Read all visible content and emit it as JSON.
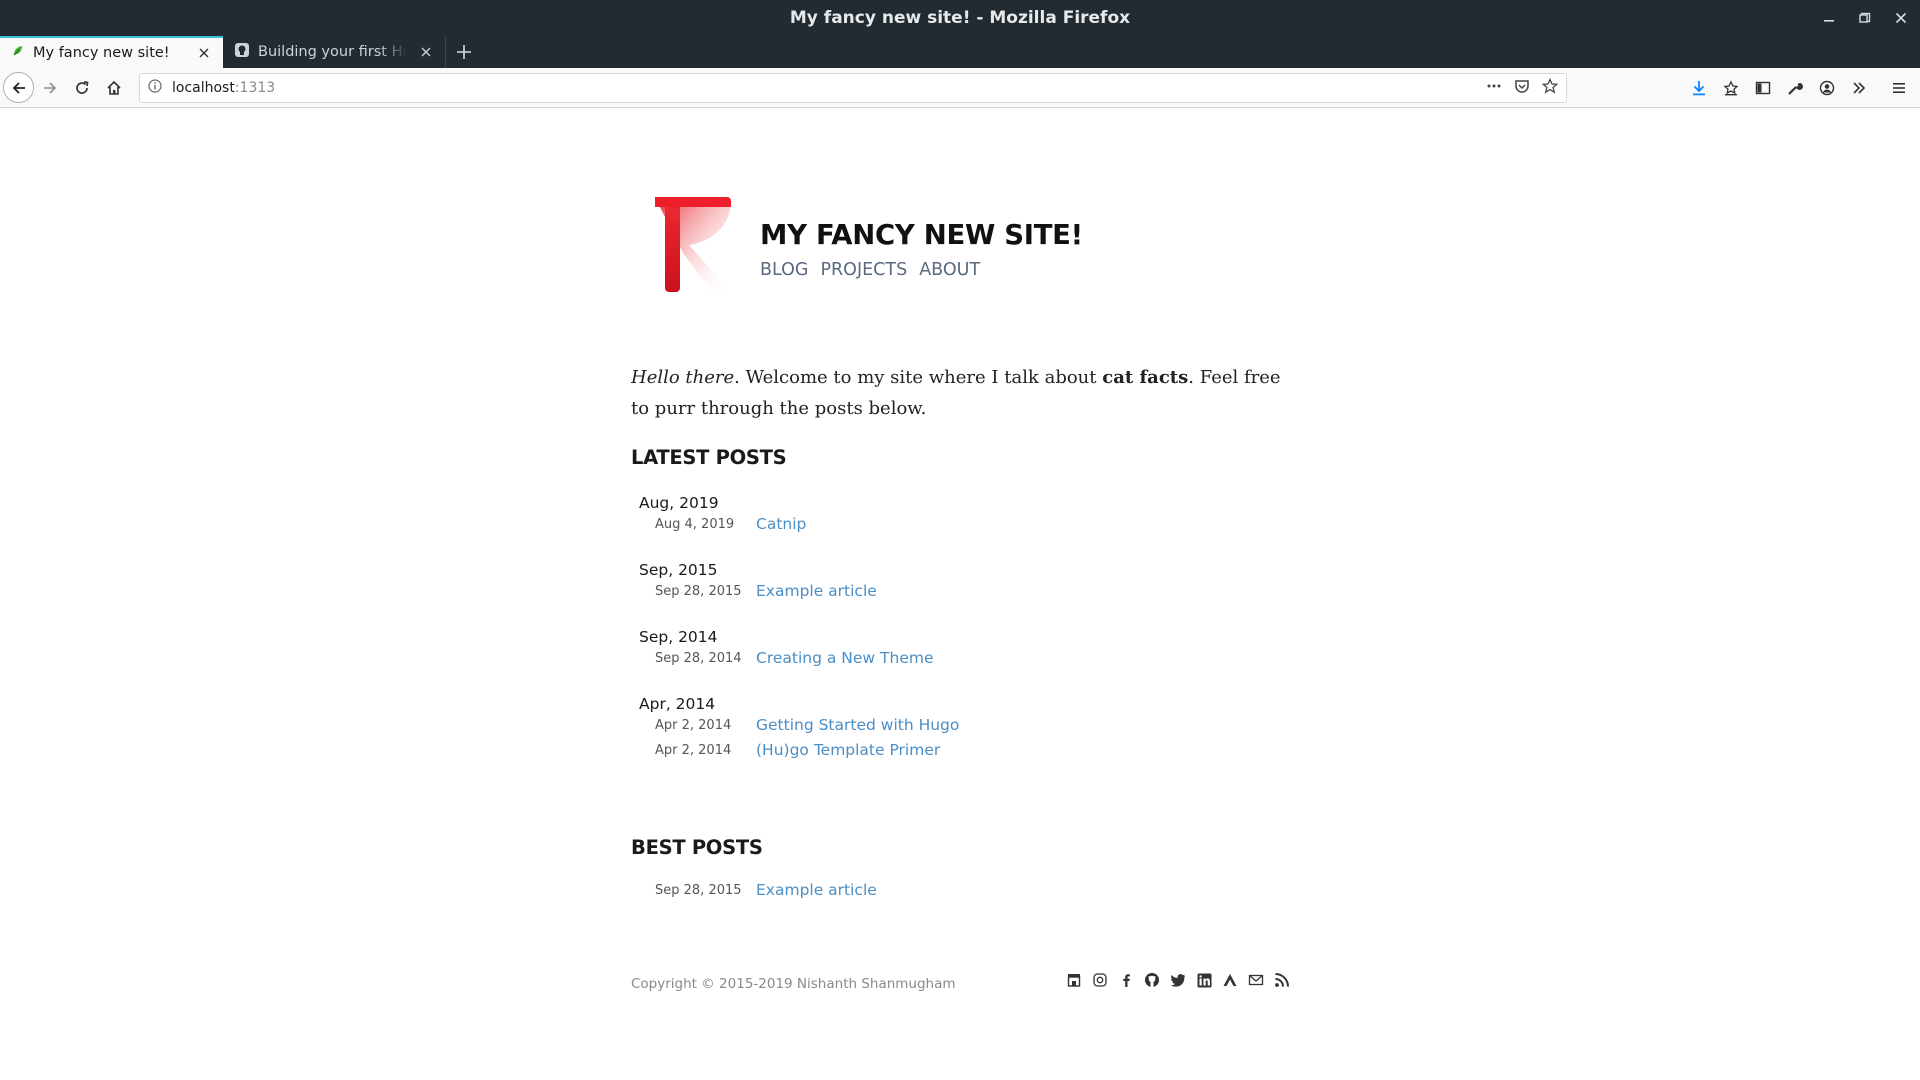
{
  "window": {
    "title": "My fancy new site! - Mozilla Firefox"
  },
  "tabs": [
    {
      "label": "My fancy new site!",
      "active": true
    },
    {
      "label": "Building your first Hugo",
      "active": false
    }
  ],
  "urlbar": {
    "host": "localhost",
    "port": ":1313"
  },
  "site": {
    "title": "MY FANCY NEW SITE!",
    "nav": [
      "BLOG",
      "PROJECTS",
      "ABOUT"
    ],
    "intro": {
      "greeting": "Hello there",
      "text1": ". Welcome to my site where I talk about ",
      "bold": "cat facts",
      "text2": ". Feel free to purr through the posts below."
    },
    "latest_title": "LATEST POSTS",
    "months": [
      {
        "label": "Aug, 2019",
        "posts": [
          {
            "date": "Aug 4, 2019",
            "title": "Catnip"
          }
        ]
      },
      {
        "label": "Sep, 2015",
        "posts": [
          {
            "date": "Sep 28, 2015",
            "title": "Example article"
          }
        ]
      },
      {
        "label": "Sep, 2014",
        "posts": [
          {
            "date": "Sep 28, 2014",
            "title": "Creating a New Theme"
          }
        ]
      },
      {
        "label": "Apr, 2014",
        "posts": [
          {
            "date": "Apr 2, 2014",
            "title": "Getting Started with Hugo"
          },
          {
            "date": "Apr 2, 2014",
            "title": "(Hu)go Template Primer"
          }
        ]
      }
    ],
    "best_title": "BEST POSTS",
    "best_posts": [
      {
        "date": "Sep 28, 2015",
        "title": "Example article"
      }
    ],
    "copyright": "Copyright © 2015-2019 Nishanth Shanmugham",
    "social_icons": [
      "store-icon",
      "instagram-icon",
      "facebook-icon",
      "github-icon",
      "twitter-icon",
      "linkedin-icon",
      "keybase-icon",
      "email-icon",
      "rss-icon"
    ]
  },
  "colors": {
    "chrome_dark": "#222b31",
    "tab_accent": "#3cc1d8",
    "link": "#4a8ec6",
    "nav_link": "#5a6a80",
    "logo_red": "#e8232c"
  }
}
